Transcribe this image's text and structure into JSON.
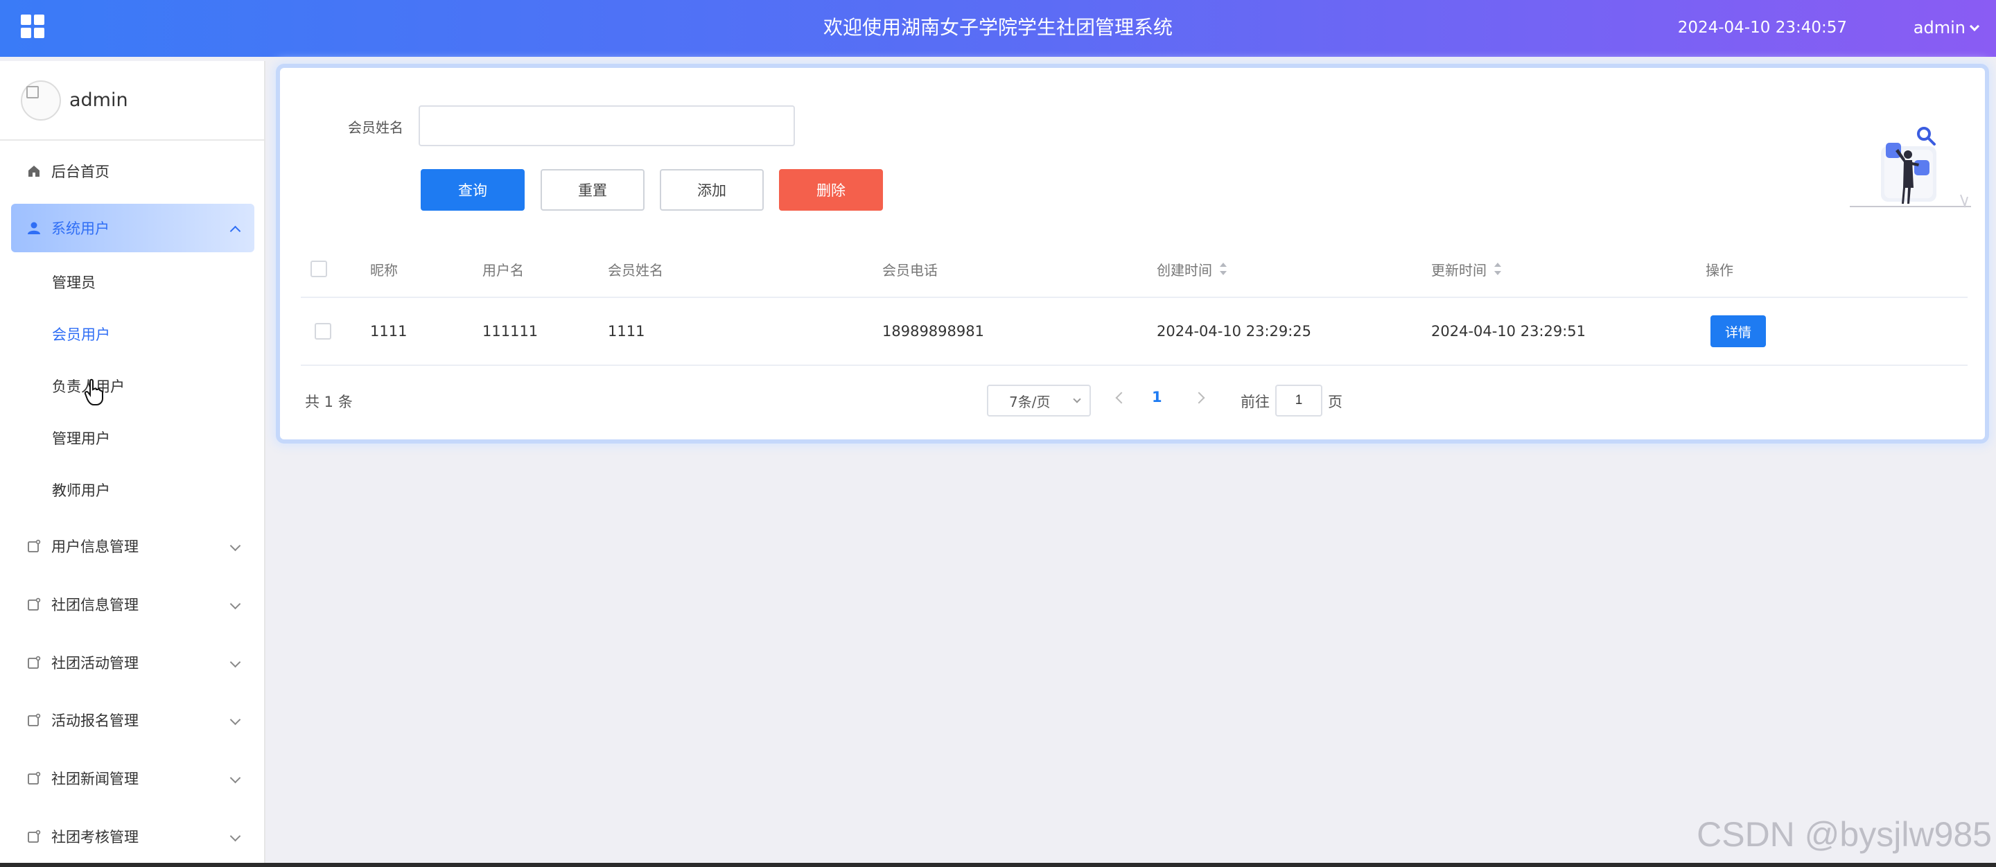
{
  "header": {
    "title": "欢迎使用湖南女子学院学生社团管理系统",
    "datetime": "2024-04-10 23:40:57",
    "user": "admin",
    "menu_icon": "grid-icon"
  },
  "sidebar": {
    "username": "admin",
    "items": [
      {
        "label": "后台首页",
        "icon": "home-icon"
      },
      {
        "label": "系统用户",
        "icon": "user-icon",
        "expanded": true,
        "children": [
          "管理员",
          "会员用户",
          "负责人用户",
          "管理用户",
          "教师用户"
        ],
        "current_child": "会员用户"
      },
      {
        "label": "用户信息管理",
        "icon": "folder-icon"
      },
      {
        "label": "社团信息管理",
        "icon": "folder-icon"
      },
      {
        "label": "社团活动管理",
        "icon": "folder-icon"
      },
      {
        "label": "活动报名管理",
        "icon": "folder-icon"
      },
      {
        "label": "社团新闻管理",
        "icon": "folder-icon"
      },
      {
        "label": "社团考核管理",
        "icon": "folder-icon"
      }
    ]
  },
  "search": {
    "label": "会员姓名",
    "value": "",
    "placeholder": ""
  },
  "buttons": {
    "query": "查询",
    "reset": "重置",
    "add": "添加",
    "delete": "删除"
  },
  "table": {
    "columns": [
      "昵称",
      "用户名",
      "会员姓名",
      "会员电话",
      "创建时间",
      "更新时间",
      "操作"
    ],
    "rows": [
      {
        "nickname": "1111",
        "username": "111111",
        "name": "1111",
        "phone": "18989898981",
        "created": "2024-04-10 23:29:25",
        "updated": "2024-04-10 23:29:51",
        "action": "详情"
      }
    ]
  },
  "pagination": {
    "total": "共 1 条",
    "page_size": "7条/页",
    "current_page": "1",
    "goto_label": "前往",
    "goto_value": "1",
    "goto_suffix": "页"
  },
  "watermark": "CSDN @bysjlw985",
  "colors": {
    "primary": "#1e7bf2",
    "danger": "#f4604c",
    "header_start": "#3a7bf7",
    "header_end": "#8a5cf3"
  }
}
